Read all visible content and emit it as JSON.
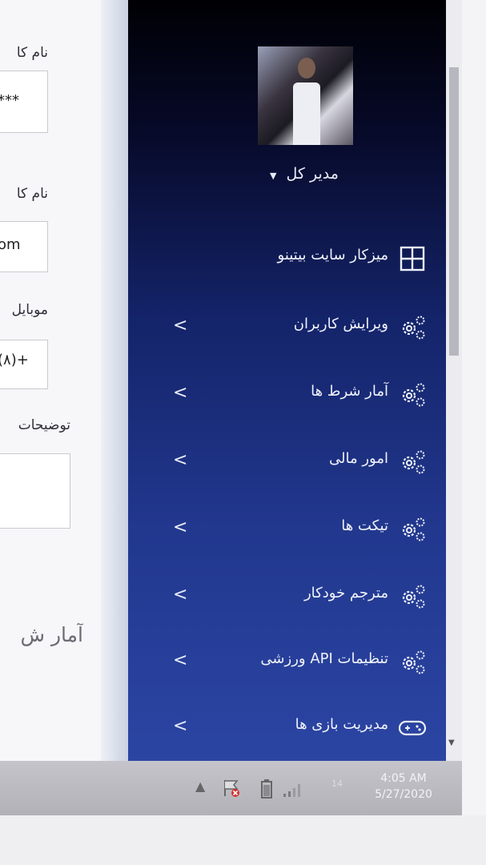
{
  "form": {
    "label1": "نام کا",
    "value1": "***",
    "label2": "نام کا",
    "value2": "om",
    "label3": "موبایل",
    "value3": "(۸)+",
    "label4": "توضیحات",
    "section_title": "آمار ش"
  },
  "sidebar": {
    "user_name": "مدیر کل",
    "user_caret": "▼",
    "items": [
      {
        "label": "میزکار سایت بیتینو",
        "icon": "dashboard-grid-icon",
        "chevron": ""
      },
      {
        "label": "ویرایش کاربران",
        "icon": "gears-icon",
        "chevron": "<"
      },
      {
        "label": "آمار شرط ها",
        "icon": "gears-icon",
        "chevron": "<"
      },
      {
        "label": "امور مالی",
        "icon": "gears-icon",
        "chevron": "<"
      },
      {
        "label": "تیکت ها",
        "icon": "gears-icon",
        "chevron": "<"
      },
      {
        "label": "مترجم خودکار",
        "icon": "gears-icon",
        "chevron": "<"
      },
      {
        "label": "تنظیمات API ورزشی",
        "icon": "gears-icon",
        "chevron": "<"
      },
      {
        "label": "مدیریت بازی ها",
        "icon": "gamepad-icon",
        "chevron": "<"
      }
    ]
  },
  "taskbar": {
    "time": "4:05 AM",
    "date": "5/27/2020",
    "tray_num": "14",
    "arrow": "▲"
  },
  "colors": {
    "sidebar_top": "#000004",
    "sidebar_bottom": "#2b45a3",
    "menu_text": "#f0f2fb"
  }
}
